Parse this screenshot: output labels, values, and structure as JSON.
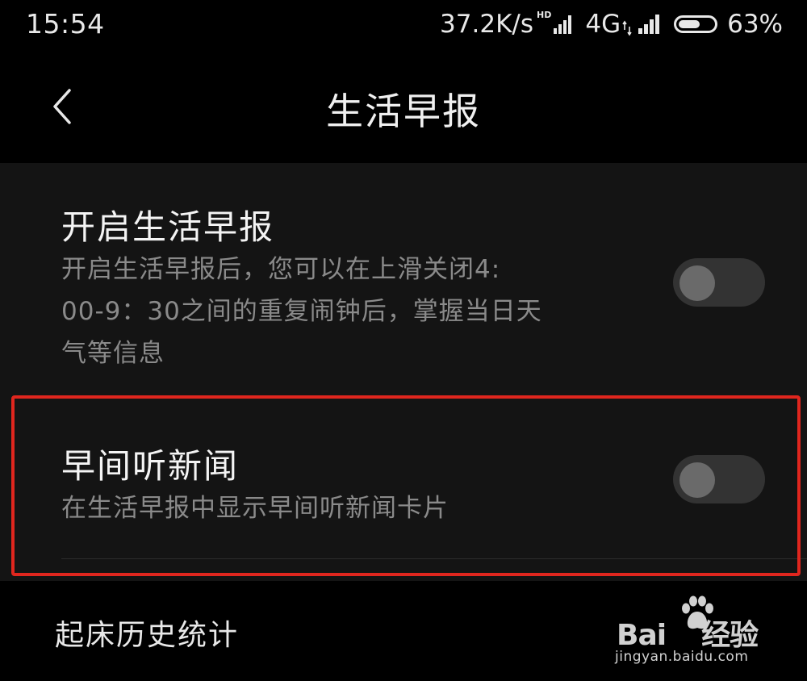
{
  "status_bar": {
    "time": "15:54",
    "net_speed": "37.2K/s",
    "hd_badge": "HD",
    "net_type": "4G",
    "battery_percent_text": "63%",
    "battery_level": 0.63
  },
  "header": {
    "title": "生活早报",
    "back_icon": "chevron-left-icon"
  },
  "settings": [
    {
      "title": "开启生活早报",
      "desc_lines": [
        "开启生活早报后，您可以在上滑关闭4:",
        "00-9：30之间的重复闹钟后，掌握当日天",
        "气等信息"
      ],
      "enabled": false
    },
    {
      "title": "早间听新闻",
      "desc_lines": [
        "在生活早报中显示早间听新闻卡片"
      ],
      "enabled": false
    }
  ],
  "bottom": {
    "history_label": "起床历史统计"
  },
  "watermark": {
    "text_left": "Bai",
    "text_right": "经验",
    "sub": "jingyan.baidu.com"
  },
  "colors": {
    "background": "#000000",
    "card": "#141414",
    "highlight_border": "#e0261e",
    "toggle_track_off": "#333333",
    "toggle_knob_off": "#6a6a6a",
    "secondary_text": "#8a8a8a"
  }
}
